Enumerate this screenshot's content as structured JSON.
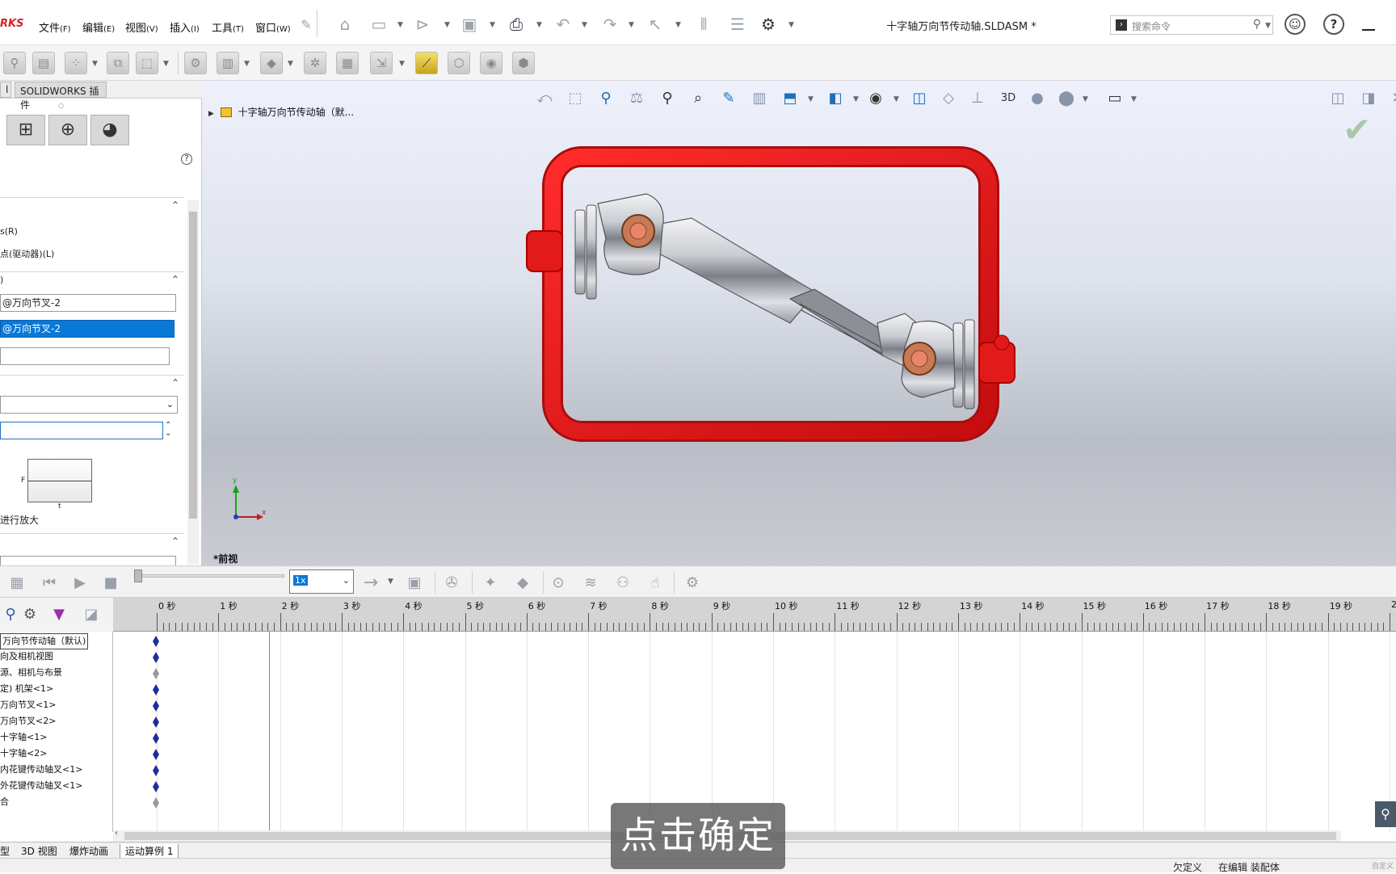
{
  "app": {
    "logo_text": "RKS",
    "document_title": "十字轴万向节传动轴.SLDASM *"
  },
  "menu": [
    {
      "label": "文件",
      "key": "(F)"
    },
    {
      "label": "编辑",
      "key": "(E)"
    },
    {
      "label": "视图",
      "key": "(V)"
    },
    {
      "label": "插入",
      "key": "(I)"
    },
    {
      "label": "工具",
      "key": "(T)"
    },
    {
      "label": "窗口",
      "key": "(W)"
    }
  ],
  "search": {
    "placeholder": "搜索命令"
  },
  "left_panel": {
    "tab_partial": "l",
    "tab_addins": "SOLIDWORKS 插件",
    "help": "?",
    "option_r": "s(R)",
    "option_l": "点(驱动器)(L)",
    "sec2_partial": ")",
    "field1": "@万向节叉-2",
    "field2": "@万向节叉-2",
    "graph_f": "F",
    "graph_t": "t",
    "zoom_hint": "进行放大"
  },
  "viewport": {
    "breadcrumb": "十字轴万向节传动轴（默...",
    "view_label": "*前视",
    "axis_x": "x",
    "axis_y": "y"
  },
  "motion": {
    "speed_value": "1x"
  },
  "tree_items": [
    "万向节传动轴（默认)",
    "向及相机视图",
    "源、相机与布景",
    "定) 机架<1>",
    "万向节叉<1>",
    "万向节叉<2>",
    "十字轴<1>",
    "十字轴<2>",
    "内花键传动轴叉<1>",
    "外花键传动轴叉<1>",
    "合"
  ],
  "timeline": {
    "ticks": [
      "0 秒",
      "1 秒",
      "2 秒",
      "3 秒",
      "4 秒",
      "5 秒",
      "6 秒",
      "7 秒",
      "8 秒",
      "9 秒",
      "10 秒",
      "11 秒",
      "12 秒",
      "13 秒",
      "14 秒",
      "15 秒",
      "16 秒",
      "17 秒",
      "18 秒",
      "19 秒",
      "2"
    ]
  },
  "bottom_tabs": [
    "型",
    "3D 视图",
    "爆炸动画",
    "运动算例 1"
  ],
  "status": {
    "definition": "欠定义",
    "editing": "在编辑 装配体",
    "custom": "自定义"
  },
  "caption": "点击确定",
  "colors": {
    "frame_red": "#e31a1a",
    "selection_blue": "#0a78d7",
    "keyframe_blue": "#1c2f9e"
  }
}
